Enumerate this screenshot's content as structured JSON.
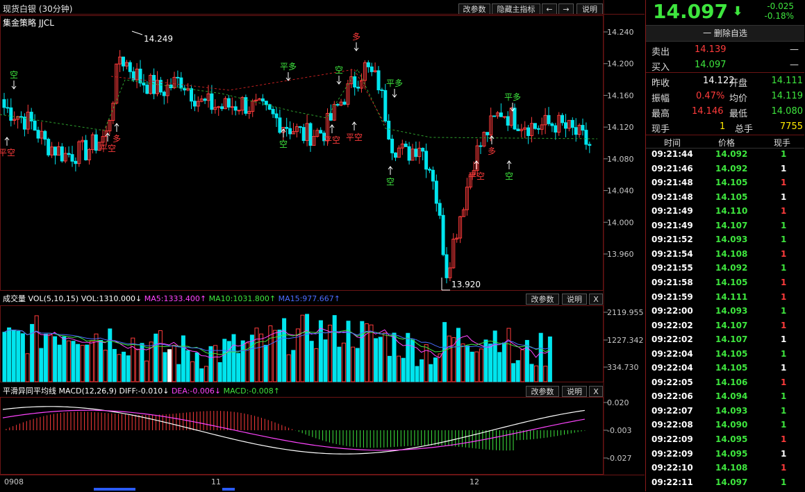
{
  "header": {
    "title": "现货白银 (30分钟)",
    "buttons": [
      "改参数",
      "隐藏主指标",
      "←",
      "→",
      "说明"
    ]
  },
  "main_chart": {
    "indicator_label": "集金策略 JJCL",
    "high_label": "14.249",
    "low_label": "13.920",
    "price_ticks": [
      "14.240",
      "14.200",
      "14.160",
      "14.120",
      "14.080",
      "14.040",
      "14.000",
      "13.960"
    ],
    "signals": [
      {
        "text": "空",
        "kind": "short"
      },
      {
        "text": "平空",
        "kind": "cover"
      },
      {
        "text": "平空",
        "kind": "cover"
      },
      {
        "text": "多",
        "kind": "long"
      },
      {
        "text": "平多",
        "kind": "sell"
      },
      {
        "text": "空",
        "kind": "short"
      },
      {
        "text": "空",
        "kind": "short"
      },
      {
        "text": "平空",
        "kind": "cover"
      },
      {
        "text": "多",
        "kind": "long"
      },
      {
        "text": "平空",
        "kind": "cover"
      },
      {
        "text": "平多",
        "kind": "sell"
      },
      {
        "text": "空",
        "kind": "short"
      },
      {
        "text": "平空",
        "kind": "cover"
      },
      {
        "text": "多",
        "kind": "long"
      },
      {
        "text": "平多",
        "kind": "sell"
      },
      {
        "text": "空",
        "kind": "short"
      }
    ]
  },
  "volume_panel": {
    "name": "成交量",
    "params": "VOL(5,10,15)",
    "vol": "VOL:1310.000↓",
    "ma5": "MA5:1333.400↑",
    "ma10": "MA10:1031.800↑",
    "ma15": "MA15:977.667↑",
    "ticks": [
      "2119.955",
      "1227.342",
      "334.730"
    ],
    "buttons": [
      "改参数",
      "说明",
      "X"
    ]
  },
  "macd_panel": {
    "name": "平滑异同平均线",
    "params": "MACD(12,26,9)",
    "diff": "DIFF:-0.010↓",
    "dea": "DEA:-0.006↓",
    "macd": "MACD:-0.008↑",
    "ticks": [
      "0.020",
      "-0.003",
      "-0.027"
    ],
    "buttons": [
      "改参数",
      "说明",
      "X"
    ]
  },
  "x_axis": [
    "0908",
    "11",
    "12"
  ],
  "quote": {
    "price": "14.097",
    "change": "-0.025",
    "change_pct": "-0.18%",
    "watchlist_button": "一 删除自选",
    "sell": {
      "label": "卖出",
      "price": "14.139",
      "vol": "—"
    },
    "buy": {
      "label": "买入",
      "price": "14.097",
      "vol": "—"
    },
    "stats": [
      {
        "l1": "昨收",
        "v1": "14.122",
        "l2": "开盘",
        "v2": "14.111"
      },
      {
        "l1": "振幅",
        "v1": "0.47%",
        "l2": "均价",
        "v2": "14.119"
      },
      {
        "l1": "最高",
        "v1": "14.146",
        "l2": "最低",
        "v2": "14.080"
      },
      {
        "l1": "现手",
        "v1": "1",
        "l2": "总手",
        "v2": "7755"
      }
    ]
  },
  "ticks": {
    "headers": [
      "时间",
      "价格",
      "现手"
    ],
    "rows": [
      {
        "t": "09:21:44",
        "p": "14.092",
        "v": "1",
        "c": "g"
      },
      {
        "t": "09:21:46",
        "p": "14.092",
        "v": "1",
        "c": "w"
      },
      {
        "t": "09:21:48",
        "p": "14.105",
        "v": "1",
        "c": "r"
      },
      {
        "t": "09:21:48",
        "p": "14.105",
        "v": "1",
        "c": "w"
      },
      {
        "t": "09:21:49",
        "p": "14.110",
        "v": "1",
        "c": "r"
      },
      {
        "t": "09:21:49",
        "p": "14.107",
        "v": "1",
        "c": "g"
      },
      {
        "t": "09:21:52",
        "p": "14.093",
        "v": "1",
        "c": "g"
      },
      {
        "t": "09:21:54",
        "p": "14.108",
        "v": "1",
        "c": "r"
      },
      {
        "t": "09:21:55",
        "p": "14.092",
        "v": "1",
        "c": "g"
      },
      {
        "t": "09:21:58",
        "p": "14.105",
        "v": "1",
        "c": "r"
      },
      {
        "t": "09:21:59",
        "p": "14.111",
        "v": "1",
        "c": "r"
      },
      {
        "t": "09:22:00",
        "p": "14.093",
        "v": "1",
        "c": "g"
      },
      {
        "t": "09:22:02",
        "p": "14.107",
        "v": "1",
        "c": "r"
      },
      {
        "t": "09:22:02",
        "p": "14.107",
        "v": "1",
        "c": "w"
      },
      {
        "t": "09:22:04",
        "p": "14.105",
        "v": "1",
        "c": "g"
      },
      {
        "t": "09:22:04",
        "p": "14.105",
        "v": "1",
        "c": "w"
      },
      {
        "t": "09:22:05",
        "p": "14.106",
        "v": "1",
        "c": "r"
      },
      {
        "t": "09:22:06",
        "p": "14.094",
        "v": "1",
        "c": "g"
      },
      {
        "t": "09:22:07",
        "p": "14.093",
        "v": "1",
        "c": "g"
      },
      {
        "t": "09:22:08",
        "p": "14.090",
        "v": "1",
        "c": "g"
      },
      {
        "t": "09:22:09",
        "p": "14.095",
        "v": "1",
        "c": "r"
      },
      {
        "t": "09:22:09",
        "p": "14.095",
        "v": "1",
        "c": "w"
      },
      {
        "t": "09:22:10",
        "p": "14.108",
        "v": "1",
        "c": "r"
      },
      {
        "t": "09:22:11",
        "p": "14.097",
        "v": "1",
        "c": "g"
      }
    ]
  },
  "colors": {
    "up": "#ff3b3b",
    "down": "#00e5ee",
    "bg": "#000000",
    "grid": "#6b1414"
  }
}
